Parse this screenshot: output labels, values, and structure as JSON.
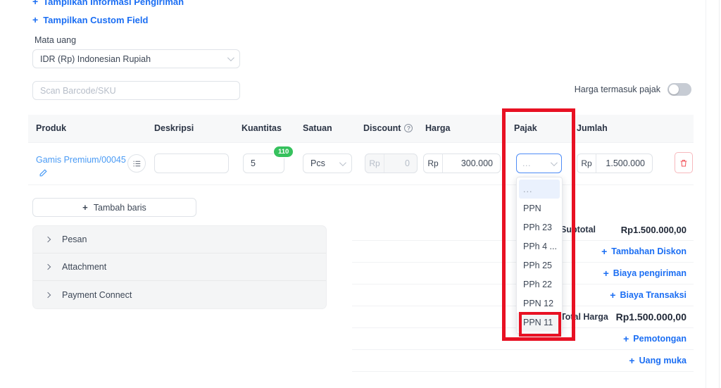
{
  "links": {
    "shipping_info": "Tampilkan Informasi Pengiriman",
    "custom_field": "Tampilkan Custom Field",
    "plus": "+"
  },
  "currency": {
    "label": "Mata uang",
    "value": "IDR (Rp) Indonesian Rupiah"
  },
  "barcode": {
    "placeholder": "Scan Barcode/SKU",
    "value": ""
  },
  "tax_inclusive": {
    "label": "Harga termasuk pajak",
    "enabled": false
  },
  "table": {
    "headers": {
      "product": "Produk",
      "description": "Deskripsi",
      "quantity": "Kuantitas",
      "unit": "Satuan",
      "discount": "Discount",
      "discount_help": "?",
      "price": "Harga",
      "tax": "Pajak",
      "amount": "Jumlah"
    },
    "row": {
      "product_name": "Gamis Premium/00045",
      "edit_icon": "pencil-icon",
      "description_value": "",
      "quantity": "5",
      "stock_badge": "110",
      "unit": "Pcs",
      "discount_prefix": "Rp",
      "discount_value": "0",
      "price_prefix": "Rp",
      "price_value": "300.000",
      "tax_value": "...",
      "amount_prefix": "Rp",
      "amount_value": "1.500.000"
    }
  },
  "tax_dropdown": {
    "options": [
      "...",
      "PPN",
      "PPh 23",
      "PPh 4 ...",
      "PPh 25",
      "PPh 22",
      "PPN 12",
      "PPN 11"
    ],
    "highlighted": "...",
    "annotated": "PPN 11"
  },
  "add_row": {
    "label": "Tambah baris"
  },
  "accordion": {
    "items": [
      "Pesan",
      "Attachment",
      "Payment Connect"
    ]
  },
  "summary": {
    "rows": [
      {
        "label": "Subtotal",
        "amount": "Rp1.500.000,00",
        "type": "amount",
        "emphasis": "normal"
      },
      {
        "label": "",
        "amount": "Tambahan Diskon",
        "type": "link"
      },
      {
        "label": "",
        "amount": "Biaya pengiriman",
        "type": "link"
      },
      {
        "label": "",
        "amount": "Biaya Transaksi",
        "type": "link"
      },
      {
        "label": "Total Harga",
        "amount": "Rp1.500.000,00",
        "type": "amount",
        "emphasis": "big"
      },
      {
        "label": "",
        "amount": "Pemotongan",
        "type": "link"
      },
      {
        "label": "",
        "amount": "Uang muka",
        "type": "link"
      }
    ]
  },
  "colors": {
    "link": "#1b6ef3",
    "annotation": "#e81123",
    "badge": "#36c15d",
    "focus": "#4f8df7"
  }
}
